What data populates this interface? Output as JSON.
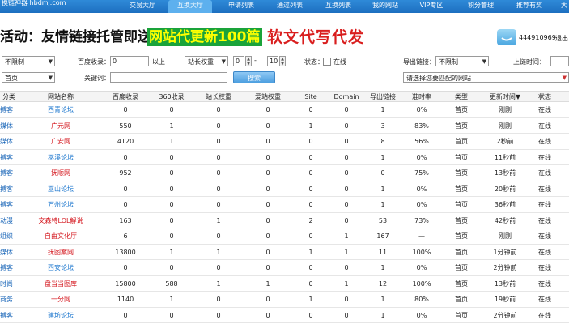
{
  "topnav": {
    "logo": "换链神器 hbdmj.com",
    "items": [
      "交易大厅",
      "互换大厅",
      "申请列表",
      "通过列表",
      "互换列表",
      "我的网站",
      "VIP专区",
      "积分管理",
      "推荐有奖",
      "大"
    ],
    "active_index": 1,
    "colors": {
      "bar": "#1d6fc0",
      "active": "#5db0ee"
    }
  },
  "banner": {
    "part1": "活动：友情链接托管即送",
    "part2": "网站代更新100篇",
    "part3": "软文代写代发",
    "qq_number": "444910969",
    "logout": "退出"
  },
  "filters": {
    "category_value": "不限制",
    "baidu_label": "百度收录：",
    "baidu_value": "0",
    "baidu_suffix": "以上",
    "weight_label": "站长权重",
    "weight_from": "0",
    "weight_to": "10",
    "status_label": "状态：",
    "online_label": "在线",
    "export_label": "导出链接：",
    "export_value": "不限制",
    "update_label": "上链时间：",
    "page_value": "首页",
    "keyword_label": "关键词：",
    "keyword_value": "",
    "search_button": "搜索",
    "match_site_value": "请选择您要匹配的网站"
  },
  "table": {
    "headers": [
      "分类",
      "网站名称",
      "百度收录",
      "360收录",
      "站长权重",
      "爱站权重",
      "Site",
      "Domain",
      "导出链接",
      "准时率",
      "类型",
      "更新时间▼",
      "状态"
    ],
    "rows": [
      {
        "cat": "搏客",
        "name": "西青论坛",
        "red": false,
        "baidu": "0",
        "s360": "0",
        "zz": "0",
        "az": "0",
        "site": "0",
        "domain": "0",
        "export": "1",
        "rate": "0%",
        "type": "首页",
        "time": "刚刚",
        "status": "在线"
      },
      {
        "cat": "媒体",
        "name": "广元网",
        "red": true,
        "baidu": "550",
        "s360": "1",
        "zz": "0",
        "az": "0",
        "site": "1",
        "domain": "0",
        "export": "3",
        "rate": "83%",
        "type": "首页",
        "time": "刚刚",
        "status": "在线"
      },
      {
        "cat": "媒体",
        "name": "广安网",
        "red": true,
        "baidu": "4120",
        "s360": "1",
        "zz": "0",
        "az": "0",
        "site": "0",
        "domain": "0",
        "export": "8",
        "rate": "56%",
        "type": "首页",
        "time": "2秒前",
        "status": "在线"
      },
      {
        "cat": "搏客",
        "name": "巫溪论坛",
        "red": false,
        "baidu": "0",
        "s360": "0",
        "zz": "0",
        "az": "0",
        "site": "0",
        "domain": "0",
        "export": "1",
        "rate": "0%",
        "type": "首页",
        "time": "11秒前",
        "status": "在线"
      },
      {
        "cat": "搏客",
        "name": "抚顺网",
        "red": true,
        "baidu": "952",
        "s360": "0",
        "zz": "0",
        "az": "0",
        "site": "0",
        "domain": "0",
        "export": "0",
        "rate": "75%",
        "type": "首页",
        "time": "13秒前",
        "status": "在线"
      },
      {
        "cat": "搏客",
        "name": "巫山论坛",
        "red": false,
        "baidu": "0",
        "s360": "0",
        "zz": "0",
        "az": "0",
        "site": "0",
        "domain": "0",
        "export": "1",
        "rate": "0%",
        "type": "首页",
        "time": "20秒前",
        "status": "在线"
      },
      {
        "cat": "搏客",
        "name": "万州论坛",
        "red": false,
        "baidu": "0",
        "s360": "0",
        "zz": "0",
        "az": "0",
        "site": "0",
        "domain": "0",
        "export": "1",
        "rate": "0%",
        "type": "首页",
        "time": "36秒前",
        "status": "在线"
      },
      {
        "cat": "动漫",
        "name": "文森特LOL解说",
        "red": true,
        "baidu": "163",
        "s360": "0",
        "zz": "1",
        "az": "0",
        "site": "2",
        "domain": "0",
        "export": "53",
        "rate": "73%",
        "type": "首页",
        "time": "42秒前",
        "status": "在线"
      },
      {
        "cat": "组织",
        "name": "自由文化厅",
        "red": true,
        "baidu": "6",
        "s360": "0",
        "zz": "0",
        "az": "0",
        "site": "0",
        "domain": "1",
        "export": "167",
        "rate": "—",
        "type": "首页",
        "time": "刚刚",
        "status": "在线"
      },
      {
        "cat": "媒体",
        "name": "抚图案网",
        "red": true,
        "baidu": "13800",
        "s360": "1",
        "zz": "1",
        "az": "0",
        "site": "1",
        "domain": "1",
        "export": "11",
        "rate": "100%",
        "type": "首页",
        "time": "1分钟前",
        "status": "在线"
      },
      {
        "cat": "搏客",
        "name": "西安论坛",
        "red": false,
        "baidu": "0",
        "s360": "0",
        "zz": "0",
        "az": "0",
        "site": "0",
        "domain": "0",
        "export": "1",
        "rate": "0%",
        "type": "首页",
        "time": "2分钟前",
        "status": "在线"
      },
      {
        "cat": "时尚",
        "name": "盘当当图库",
        "red": true,
        "baidu": "15800",
        "s360": "588",
        "zz": "1",
        "az": "1",
        "site": "0",
        "domain": "1",
        "export": "12",
        "rate": "100%",
        "type": "首页",
        "time": "13秒前",
        "status": "在线"
      },
      {
        "cat": "商务",
        "name": "一分网",
        "red": true,
        "baidu": "1140",
        "s360": "1",
        "zz": "0",
        "az": "0",
        "site": "1",
        "domain": "0",
        "export": "1",
        "rate": "80%",
        "type": "首页",
        "time": "19秒前",
        "status": "在线"
      },
      {
        "cat": "搏客",
        "name": "建坊论坛",
        "red": false,
        "baidu": "0",
        "s360": "0",
        "zz": "0",
        "az": "0",
        "site": "0",
        "domain": "0",
        "export": "1",
        "rate": "0%",
        "type": "首页",
        "time": "2分钟前",
        "status": "在线"
      }
    ]
  }
}
